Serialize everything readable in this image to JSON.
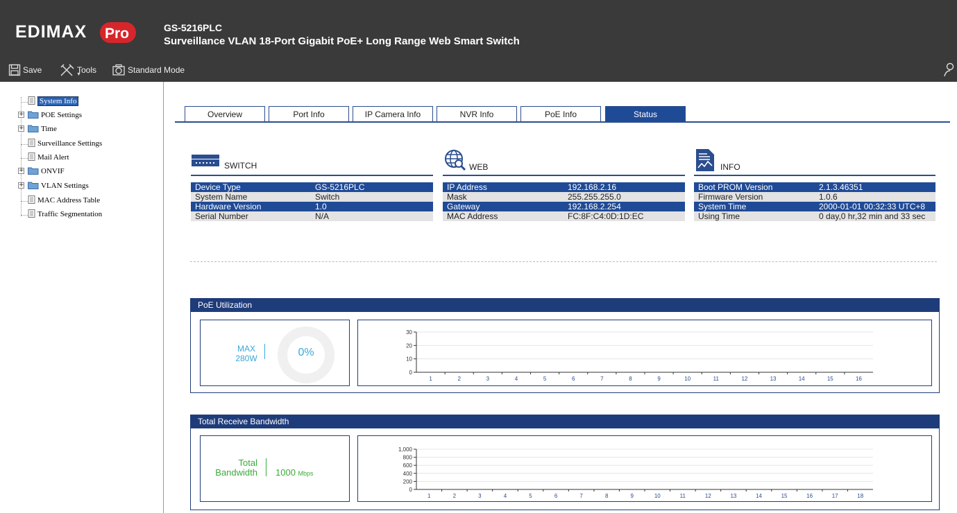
{
  "header": {
    "logo_text": "EDIMAX Pro",
    "model": "GS-5216PLC",
    "description": "Surveillance VLAN 18-Port Gigabit PoE+ Long Range Web Smart Switch"
  },
  "toolbar": {
    "save": "Save",
    "tools": "Tools",
    "mode": "Standard Mode"
  },
  "sidebar": {
    "items": [
      {
        "label": "System Info"
      },
      {
        "label": "POE Settings"
      },
      {
        "label": "Time"
      },
      {
        "label": "Surveillance Settings"
      },
      {
        "label": "Mail Alert"
      },
      {
        "label": "ONVIF"
      },
      {
        "label": "VLAN Settings"
      },
      {
        "label": "MAC Address Table"
      },
      {
        "label": "Traffic Segmentation"
      }
    ]
  },
  "tabs": [
    "Overview",
    "Port Info",
    "IP Camera Info",
    "NVR Info",
    "PoE Info",
    "Status"
  ],
  "active_tab": "Status",
  "switch_panel": {
    "title": "SWITCH",
    "rows": [
      {
        "key": "Device Type",
        "value": "GS-5216PLC"
      },
      {
        "key": "System Name",
        "value": "Switch"
      },
      {
        "key": "Hardware Version",
        "value": "1.0"
      },
      {
        "key": "Serial Number",
        "value": "N/A"
      }
    ]
  },
  "web_panel": {
    "title": "WEB",
    "rows": [
      {
        "key": "IP Address",
        "value": "192.168.2.16"
      },
      {
        "key": "Mask",
        "value": "255.255.255.0"
      },
      {
        "key": "Gateway",
        "value": "192.168.2.254"
      },
      {
        "key": "MAC Address",
        "value": "FC:8F:C4:0D:1D:EC"
      }
    ]
  },
  "info_panel": {
    "title": "INFO",
    "rows": [
      {
        "key": "Boot PROM Version",
        "value": "2.1.3.46351"
      },
      {
        "key": "Firmware Version",
        "value": "1.0.6"
      },
      {
        "key": "System Time",
        "value": "2000-01-01 00:32:33 UTC+8"
      },
      {
        "key": "Using Time",
        "value": "0 day,0 hr,32 min and 33 sec"
      }
    ]
  },
  "poe": {
    "title": "PoE Utilization",
    "max_label": "MAX",
    "max_value": "280W",
    "percent": "0%",
    "utilization_fraction": 0
  },
  "bandwidth": {
    "title": "Total Receive Bandwidth",
    "label_line1": "Total",
    "label_line2": "Bandwidth",
    "value": "1000",
    "unit": "Mbps"
  },
  "colors": {
    "header_bg": "#3a3a3a",
    "accent": "#1f4a96",
    "poe_text": "#3aa8d8",
    "bandwidth_text": "#3aaa3a"
  },
  "chart_data": [
    {
      "type": "bar",
      "categories": [
        "1",
        "2",
        "3",
        "4",
        "5",
        "6",
        "7",
        "8",
        "9",
        "10",
        "11",
        "12",
        "13",
        "14",
        "15",
        "16"
      ],
      "values": [
        0,
        0,
        0,
        0,
        0,
        0,
        0,
        0,
        0,
        0,
        0,
        0,
        0,
        0,
        0,
        0
      ],
      "yticks": [
        0,
        10,
        20,
        30
      ],
      "ylim": [
        0,
        30
      ],
      "grid": true
    },
    {
      "type": "bar",
      "categories": [
        "1",
        "2",
        "3",
        "4",
        "5",
        "6",
        "7",
        "8",
        "9",
        "10",
        "11",
        "12",
        "13",
        "14",
        "15",
        "16",
        "17",
        "18"
      ],
      "values": [
        0,
        0,
        0,
        0,
        0,
        0,
        0,
        0,
        0,
        0,
        0,
        0,
        0,
        0,
        0,
        0,
        0,
        0
      ],
      "yticks": [
        "0",
        "200",
        "400",
        "600",
        "800",
        "1,000"
      ],
      "ylim": [
        0,
        1000
      ],
      "grid": true
    }
  ]
}
